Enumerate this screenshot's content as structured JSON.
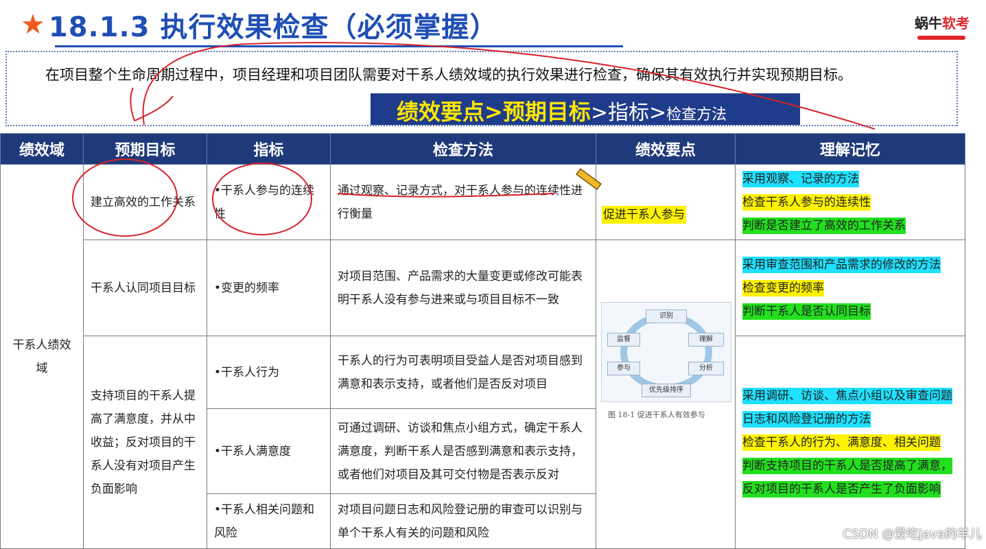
{
  "header": {
    "star": "★",
    "title": "18.1.3 执行效果检查（必须掌握）",
    "logo_a": "蜗牛",
    "logo_b": "软考"
  },
  "intro": {
    "text": "在项目整个生命周期过程中，项目经理和项目团队需要对干系人绩效域的执行效果进行检查，确保其有效执行并实现预期目标。"
  },
  "banner": {
    "part1": "绩效要点>预期目标",
    "part2": ">指标>",
    "part3": "检查方法"
  },
  "table": {
    "headers": [
      "绩效域",
      "预期目标",
      "指标",
      "检查方法",
      "绩效要点",
      "理解记忆"
    ],
    "domain": "干系人绩效域",
    "rows": [
      {
        "goal": "建立高效的工作关系",
        "indicator": "•干系人参与的连续性",
        "method": "通过观察、记录方式，对干系人参与的连续性进行衡量"
      },
      {
        "goal": "干系人认同项目目标",
        "indicator": "•变更的频率",
        "method": "对项目范围、产品需求的大量变更或修改可能表明干系人没有参与进来或与项目目标不一致"
      },
      {
        "goal": "支持项目的干系人提高了满意度，并从中收益；反对项目的干系人没有对项目产生负面影响",
        "indicator": "•干系人行为",
        "method": "干系人的行为可表明项目受益人是否对项目感到满意和表示支持，或者他们是否反对项目"
      },
      {
        "indicator": "•干系人满意度",
        "method": "可通过调研、访谈和焦点小组方式，确定干系人满意度，判断干系人是否感到满意和表示支持，或者他们对项目及其可交付物是否表示反对"
      },
      {
        "indicator": "•干系人相关问题和风险",
        "method": "对项目问题日志和风险登记册的审查可以识别与单个干系人有关的问题和风险"
      }
    ],
    "point": "促进干系人参与",
    "figure": {
      "nodes": [
        "识别",
        "理解",
        "分析",
        "优先级排序",
        "参与",
        "监督"
      ],
      "caption": "图 18-1   促进干系人有效参与"
    },
    "memory": [
      {
        "lines": [
          {
            "text": "采用观察、记录的方法",
            "color": "cyan"
          },
          {
            "text": "检查干系人参与的连续性",
            "color": "yellow"
          },
          {
            "text": "判断是否建立了高效的工作关系",
            "color": "green"
          }
        ]
      },
      {
        "lines": [
          {
            "text": "采用审查范围和产品需求的修改的方法",
            "color": "cyan"
          },
          {
            "text": "检查变更的频率",
            "color": "yellow"
          },
          {
            "text": "判断干系人是否认同目标",
            "color": "green"
          }
        ]
      },
      {
        "lines": [
          {
            "text": "采用调研、访谈、焦点小组以及审查问题日志和风险登记册的方法",
            "color": "cyan"
          },
          {
            "text": "检查干系人的行为、满意度、相关问题",
            "color": "yellow"
          },
          {
            "text": "判断支持项目的干系人是否提高了满意，反对项目的干系人是否产生了负面影响",
            "color": "green"
          }
        ]
      }
    ]
  },
  "watermark": "CSDN @爱吃java的羊儿",
  "colors": {
    "title_blue": "#1f4fb5",
    "header_navy": "#1f3a7a",
    "star_orange": "#ef5a1f",
    "highlight_cyan": "#1ee0ff",
    "highlight_yellow": "#fff200",
    "highlight_green": "#22e01e",
    "ink_red": "#d9222a"
  }
}
